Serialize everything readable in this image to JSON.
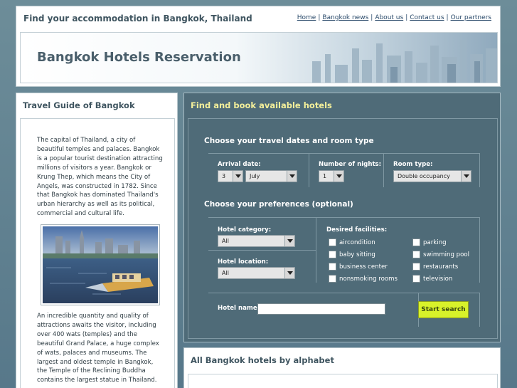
{
  "header": {
    "tagline": "Find your accommodation in Bangkok, Thailand",
    "nav": [
      {
        "label": "Home"
      },
      {
        "label": "Bangkok news"
      },
      {
        "label": "About us"
      },
      {
        "label": "Contact us"
      },
      {
        "label": "Our partners"
      }
    ],
    "separator": "|",
    "banner_title": "Bangkok Hotels Reservation"
  },
  "guide": {
    "title": "Travel Guide of Bangkok",
    "paragraph1": "The capital of Thailand, a city of beautiful temples and palaces. Bangkok is a popular tourist destination attracting millions of visitors a year. Bangkok or Krung Thep, which means the City of Angels, was constructed in 1782. Since that Bangkok has dominated Thailand's urban hierarchy as well as its political, commercial and cultural life.",
    "paragraph2": "An incredible quantity and quality of attractions awaits the visitor, including over 400 wats (temples) and the beautiful Grand Palace, a huge complex of wats, palaces and museums. The largest and oldest temple in Bangkok, the Temple of the Reclining Buddha contains the largest statue in Thailand."
  },
  "search": {
    "title": "Find and book available hotels",
    "dates_section": "Choose your travel dates and room type",
    "arrival_label": "Arrival date:",
    "arrival_day": "3",
    "arrival_month": "July",
    "nights_label": "Number of nights:",
    "nights_value": "1",
    "room_label": "Room type:",
    "room_value": "Double occupancy",
    "prefs_section": "Choose your preferences (optional)",
    "category_label": "Hotel category:",
    "category_value": "All",
    "location_label": "Hotel location:",
    "location_value": "All",
    "facilities_label": "Desired facilities:",
    "facilities": [
      {
        "label": "aircondition"
      },
      {
        "label": "parking"
      },
      {
        "label": "baby sitting"
      },
      {
        "label": "swimming pool"
      },
      {
        "label": "business center"
      },
      {
        "label": "restaurants"
      },
      {
        "label": "nonsmoking rooms"
      },
      {
        "label": "television"
      }
    ],
    "hotel_name_label": "Hotel name:",
    "hotel_name_value": "",
    "start_button": "Start search"
  },
  "alphabet": {
    "title": "All Bangkok hotels by alphabet"
  },
  "colors": {
    "accent_title": "#f4ef9a",
    "button": "#d8f22a",
    "panel": "#4f6b78"
  }
}
